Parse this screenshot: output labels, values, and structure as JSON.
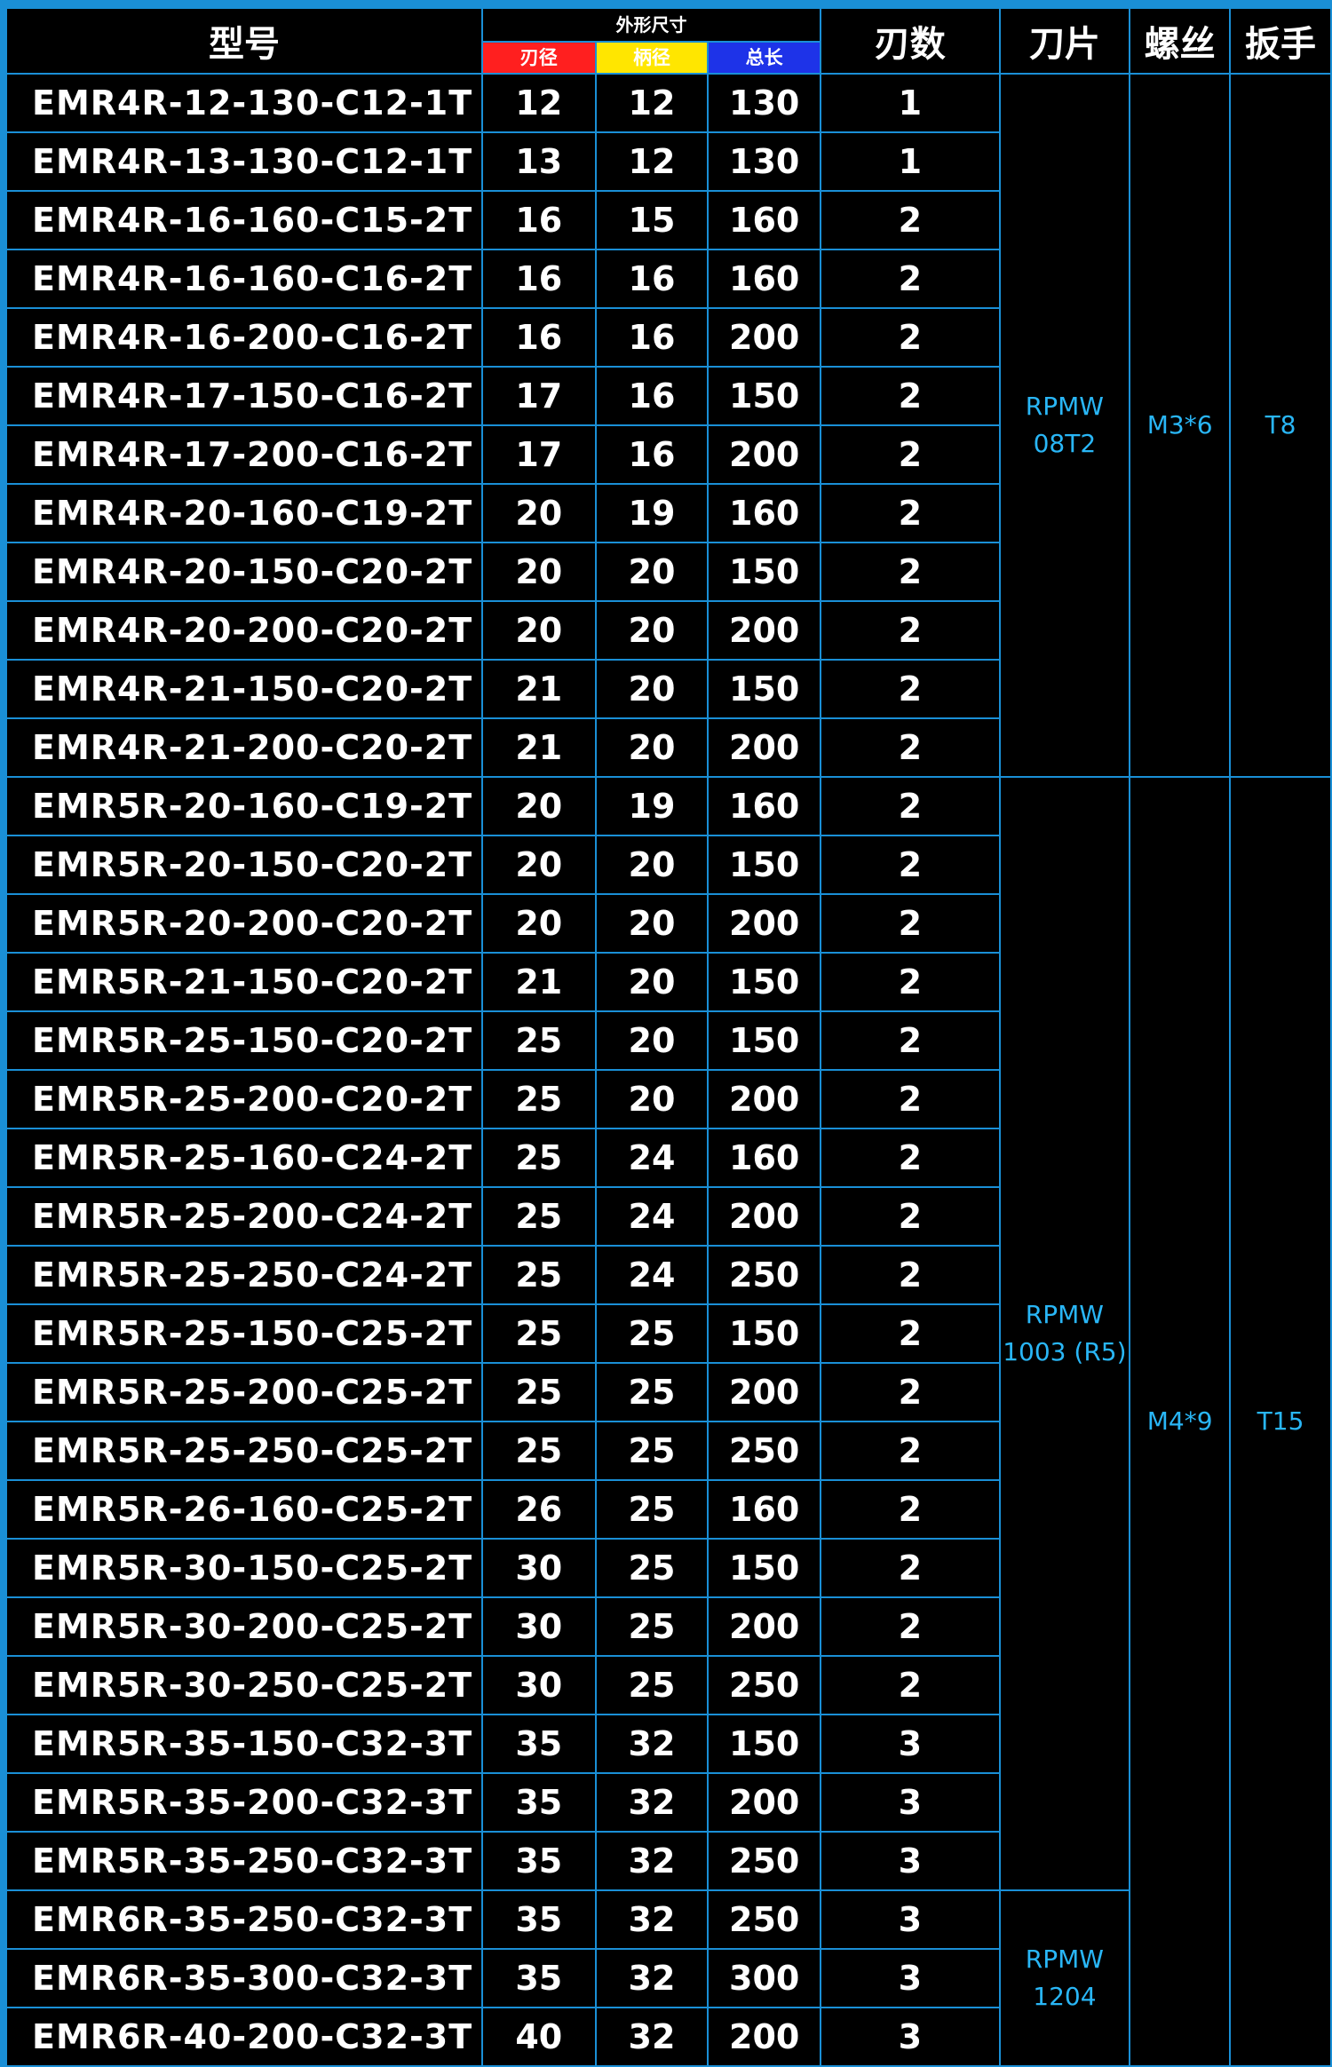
{
  "header": {
    "model": "型号",
    "dimensions_group": "外形尺寸",
    "blade_diameter": "刃径",
    "shank_diameter": "柄径",
    "total_length": "总长",
    "flutes": "刃数",
    "insert": "刀片",
    "screw": "螺丝",
    "wrench": "扳手"
  },
  "rows": [
    {
      "model": "EMR4R-12-130-C12-1T",
      "d": "12",
      "shank": "12",
      "length": "130",
      "flutes": "1"
    },
    {
      "model": "EMR4R-13-130-C12-1T",
      "d": "13",
      "shank": "12",
      "length": "130",
      "flutes": "1"
    },
    {
      "model": "EMR4R-16-160-C15-2T",
      "d": "16",
      "shank": "15",
      "length": "160",
      "flutes": "2"
    },
    {
      "model": "EMR4R-16-160-C16-2T",
      "d": "16",
      "shank": "16",
      "length": "160",
      "flutes": "2"
    },
    {
      "model": "EMR4R-16-200-C16-2T",
      "d": "16",
      "shank": "16",
      "length": "200",
      "flutes": "2"
    },
    {
      "model": "EMR4R-17-150-C16-2T",
      "d": "17",
      "shank": "16",
      "length": "150",
      "flutes": "2"
    },
    {
      "model": "EMR4R-17-200-C16-2T",
      "d": "17",
      "shank": "16",
      "length": "200",
      "flutes": "2"
    },
    {
      "model": "EMR4R-20-160-C19-2T",
      "d": "20",
      "shank": "19",
      "length": "160",
      "flutes": "2"
    },
    {
      "model": "EMR4R-20-150-C20-2T",
      "d": "20",
      "shank": "20",
      "length": "150",
      "flutes": "2"
    },
    {
      "model": "EMR4R-20-200-C20-2T",
      "d": "20",
      "shank": "20",
      "length": "200",
      "flutes": "2"
    },
    {
      "model": "EMR4R-21-150-C20-2T",
      "d": "21",
      "shank": "20",
      "length": "150",
      "flutes": "2"
    },
    {
      "model": "EMR4R-21-200-C20-2T",
      "d": "21",
      "shank": "20",
      "length": "200",
      "flutes": "2"
    },
    {
      "model": "EMR5R-20-160-C19-2T",
      "d": "20",
      "shank": "19",
      "length": "160",
      "flutes": "2"
    },
    {
      "model": "EMR5R-20-150-C20-2T",
      "d": "20",
      "shank": "20",
      "length": "150",
      "flutes": "2"
    },
    {
      "model": "EMR5R-20-200-C20-2T",
      "d": "20",
      "shank": "20",
      "length": "200",
      "flutes": "2"
    },
    {
      "model": "EMR5R-21-150-C20-2T",
      "d": "21",
      "shank": "20",
      "length": "150",
      "flutes": "2"
    },
    {
      "model": "EMR5R-25-150-C20-2T",
      "d": "25",
      "shank": "20",
      "length": "150",
      "flutes": "2"
    },
    {
      "model": "EMR5R-25-200-C20-2T",
      "d": "25",
      "shank": "20",
      "length": "200",
      "flutes": "2"
    },
    {
      "model": "EMR5R-25-160-C24-2T",
      "d": "25",
      "shank": "24",
      "length": "160",
      "flutes": "2"
    },
    {
      "model": "EMR5R-25-200-C24-2T",
      "d": "25",
      "shank": "24",
      "length": "200",
      "flutes": "2"
    },
    {
      "model": "EMR5R-25-250-C24-2T",
      "d": "25",
      "shank": "24",
      "length": "250",
      "flutes": "2"
    },
    {
      "model": "EMR5R-25-150-C25-2T",
      "d": "25",
      "shank": "25",
      "length": "150",
      "flutes": "2"
    },
    {
      "model": "EMR5R-25-200-C25-2T",
      "d": "25",
      "shank": "25",
      "length": "200",
      "flutes": "2"
    },
    {
      "model": "EMR5R-25-250-C25-2T",
      "d": "25",
      "shank": "25",
      "length": "250",
      "flutes": "2"
    },
    {
      "model": "EMR5R-26-160-C25-2T",
      "d": "26",
      "shank": "25",
      "length": "160",
      "flutes": "2"
    },
    {
      "model": "EMR5R-30-150-C25-2T",
      "d": "30",
      "shank": "25",
      "length": "150",
      "flutes": "2"
    },
    {
      "model": "EMR5R-30-200-C25-2T",
      "d": "30",
      "shank": "25",
      "length": "200",
      "flutes": "2"
    },
    {
      "model": "EMR5R-30-250-C25-2T",
      "d": "30",
      "shank": "25",
      "length": "250",
      "flutes": "2"
    },
    {
      "model": "EMR5R-35-150-C32-3T",
      "d": "35",
      "shank": "32",
      "length": "150",
      "flutes": "3"
    },
    {
      "model": "EMR5R-35-200-C32-3T",
      "d": "35",
      "shank": "32",
      "length": "200",
      "flutes": "3"
    },
    {
      "model": "EMR5R-35-250-C32-3T",
      "d": "35",
      "shank": "32",
      "length": "250",
      "flutes": "3"
    },
    {
      "model": "EMR6R-35-250-C32-3T",
      "d": "35",
      "shank": "32",
      "length": "250",
      "flutes": "3"
    },
    {
      "model": "EMR6R-35-300-C32-3T",
      "d": "35",
      "shank": "32",
      "length": "300",
      "flutes": "3"
    },
    {
      "model": "EMR6R-40-200-C32-3T",
      "d": "40",
      "shank": "32",
      "length": "200",
      "flutes": "3"
    }
  ],
  "accessories": {
    "insert_emr4r": "RPMW 08T2",
    "screw_emr4r": "M3*6",
    "wrench_emr4r": "T8",
    "insert_emr5r": "RPMW 1003 (R5)",
    "screw_emr5r_emr6r": "M4*9",
    "wrench_emr5r_emr6r": "T15",
    "insert_emr6r": "RPMW 1204"
  },
  "colors": {
    "background": "#000000",
    "grid_lines": "#1a8fd6",
    "accessory_text": "#29b6f6",
    "blade_diameter_header": "#ff1f1f",
    "shank_diameter_header": "#ffe600",
    "total_length_header": "#1e33e8"
  }
}
